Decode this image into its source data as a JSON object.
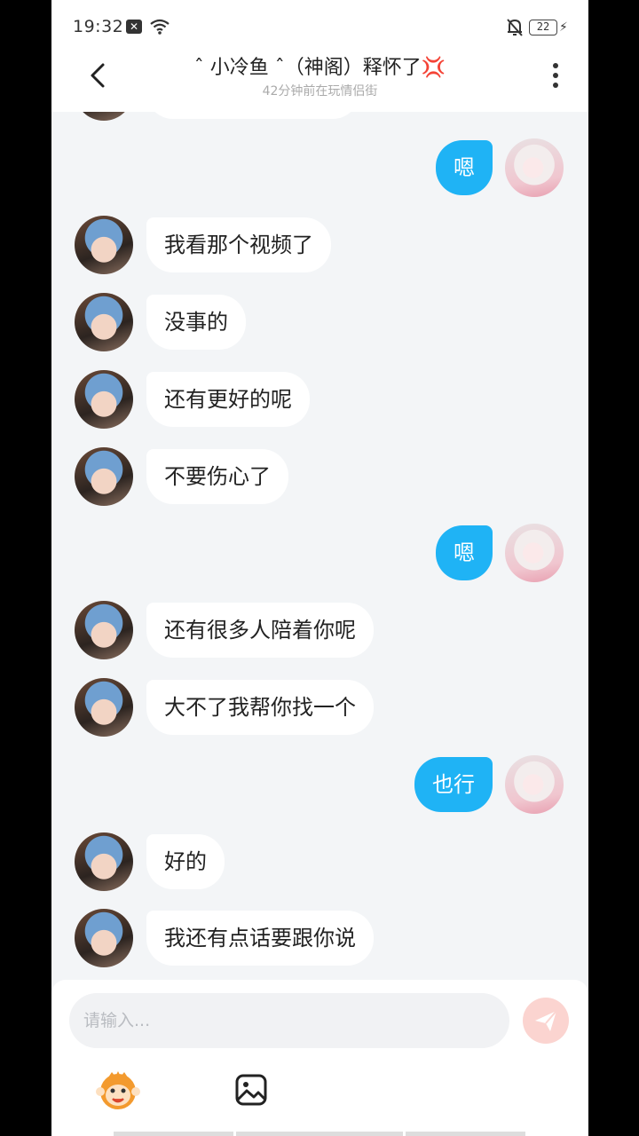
{
  "status_bar": {
    "time": "19:32",
    "battery": "22"
  },
  "header": {
    "title": "ˆ 小冷鱼 ˆ（神阁）释怀了💢",
    "subtitle": "42分钟前在玩情侣街"
  },
  "messages": [
    {
      "side": "right",
      "text": "嗯"
    },
    {
      "side": "left",
      "text": "我看那个视频了"
    },
    {
      "side": "left",
      "text": "没事的"
    },
    {
      "side": "left",
      "text": "还有更好的呢"
    },
    {
      "side": "left",
      "text": "不要伤心了"
    },
    {
      "side": "right",
      "text": "嗯"
    },
    {
      "side": "left",
      "text": "还有很多人陪着你呢"
    },
    {
      "side": "left",
      "text": "大不了我帮你找一个"
    },
    {
      "side": "right",
      "text": "也行"
    },
    {
      "side": "left",
      "text": "好的"
    },
    {
      "side": "left",
      "text": "我还有点话要跟你说"
    }
  ],
  "input": {
    "placeholder": "请输入..."
  },
  "colors": {
    "sent_bubble": "#1fb3f5",
    "received_bubble": "#ffffff",
    "chat_background": "#f3f5f7",
    "send_button": "#fbd4d0"
  },
  "icons": {
    "back": "chevron-left-icon",
    "more": "more-vertical-icon",
    "send": "paper-plane-icon",
    "emoji": "monkey-emoji-icon",
    "image": "image-icon"
  }
}
